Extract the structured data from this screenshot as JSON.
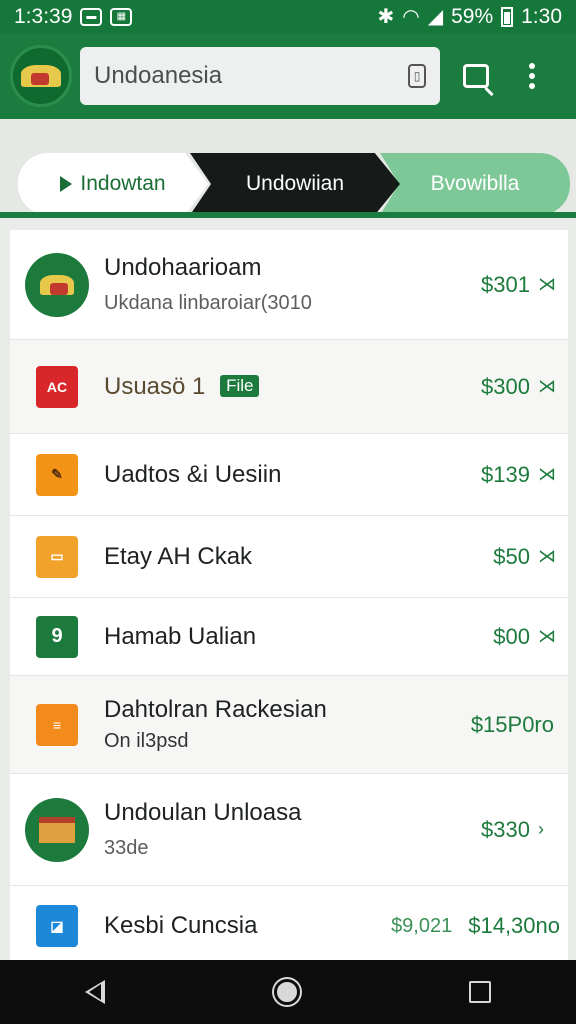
{
  "status_bar": {
    "time": "1:3:39",
    "battery_text": "59%",
    "clock_right": "1:30",
    "icons": [
      "notification-icon",
      "media-icon",
      "bluetooth-icon",
      "wifi-icon",
      "signal-icon",
      "battery-icon"
    ]
  },
  "app_bar": {
    "search_text": "Undoanesia",
    "icons": [
      "app-logo",
      "search-icon",
      "more-vert-icon"
    ]
  },
  "tabs": [
    {
      "label": "Indowtan"
    },
    {
      "label": "Undowiian"
    },
    {
      "label": "Bvowiblla"
    }
  ],
  "list": [
    {
      "title": "Undohaarioam",
      "subtitle": "Ukdana linbaroiar(3010",
      "price": "$301",
      "icon": "eagle-logo"
    },
    {
      "title": "Usuasö 1",
      "badge": "File",
      "price": "$300",
      "icon": "ac-icon"
    },
    {
      "title": "Uadtos &i Uesiin",
      "price": "$139",
      "icon": "tool-icon"
    },
    {
      "title": "Etay AH Ckak",
      "price": "$50",
      "icon": "folder-icon"
    },
    {
      "title": "Hamab Ualian",
      "price": "$00",
      "icon": "green-app-icon"
    },
    {
      "title": "Dahtolran Rackesian",
      "subtitle": "On il3psd",
      "price": "$15P0ro",
      "icon": "doc-icon"
    },
    {
      "title": "Undoulan Unloasa",
      "subtitle": "33de",
      "price": "$330",
      "icon": "building-logo"
    },
    {
      "title": "Kesbi Cuncsia",
      "price_alt": "$9,021",
      "price": "$14,30no",
      "icon": "chart-icon"
    }
  ],
  "colors": {
    "primary": "#1a7d3f",
    "accent": "#1d7a3d",
    "tab_dark": "#161b19",
    "tab_light": "#7ec898"
  }
}
